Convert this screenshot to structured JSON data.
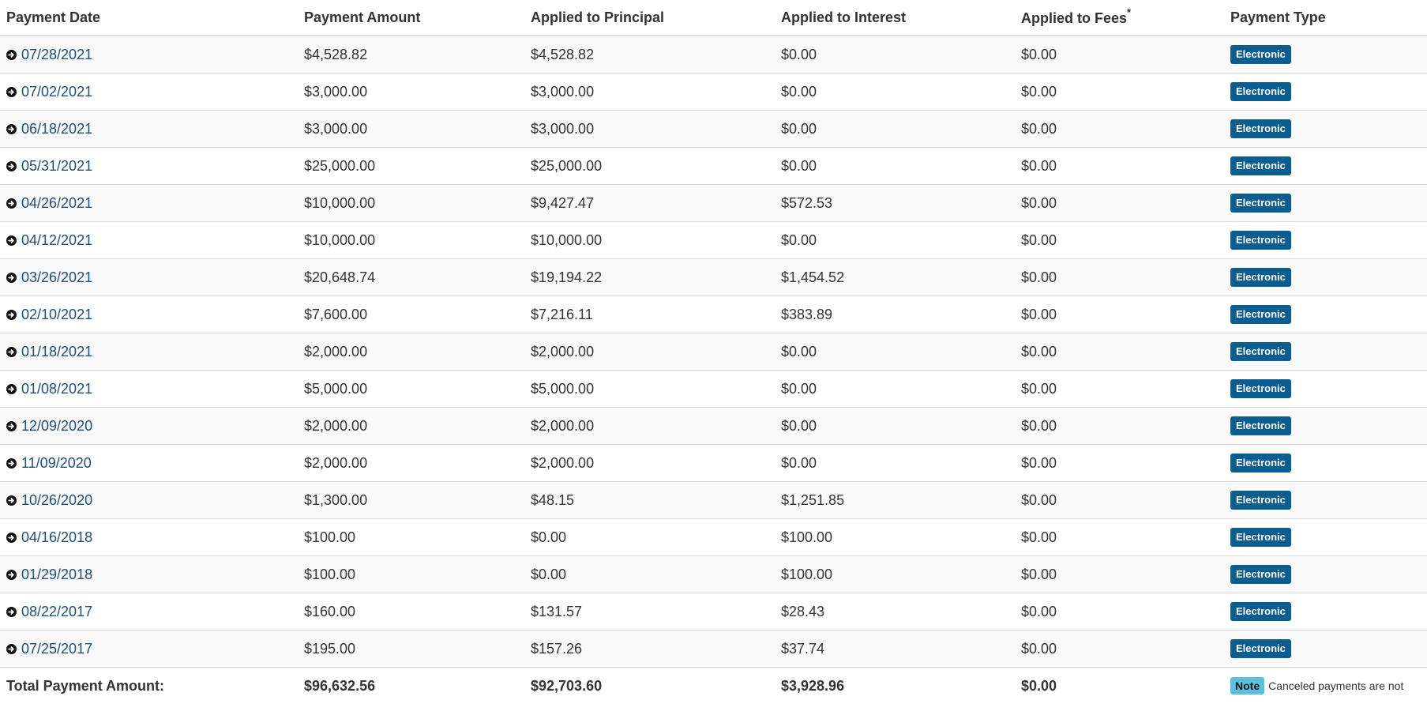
{
  "table": {
    "headers": {
      "payment_date": "Payment Date",
      "payment_amount": "Payment Amount",
      "applied_principal": "Applied to Principal",
      "applied_interest": "Applied to Interest",
      "applied_fees": "Applied to Fees",
      "applied_fees_marker": "*",
      "payment_type": "Payment Type"
    },
    "rows": [
      {
        "date": "07/28/2021",
        "amount": "$4,528.82",
        "principal": "$4,528.82",
        "interest": "$0.00",
        "fees": "$0.00",
        "type": "Electronic"
      },
      {
        "date": "07/02/2021",
        "amount": "$3,000.00",
        "principal": "$3,000.00",
        "interest": "$0.00",
        "fees": "$0.00",
        "type": "Electronic"
      },
      {
        "date": "06/18/2021",
        "amount": "$3,000.00",
        "principal": "$3,000.00",
        "interest": "$0.00",
        "fees": "$0.00",
        "type": "Electronic"
      },
      {
        "date": "05/31/2021",
        "amount": "$25,000.00",
        "principal": "$25,000.00",
        "interest": "$0.00",
        "fees": "$0.00",
        "type": "Electronic"
      },
      {
        "date": "04/26/2021",
        "amount": "$10,000.00",
        "principal": "$9,427.47",
        "interest": "$572.53",
        "fees": "$0.00",
        "type": "Electronic"
      },
      {
        "date": "04/12/2021",
        "amount": "$10,000.00",
        "principal": "$10,000.00",
        "interest": "$0.00",
        "fees": "$0.00",
        "type": "Electronic"
      },
      {
        "date": "03/26/2021",
        "amount": "$20,648.74",
        "principal": "$19,194.22",
        "interest": "$1,454.52",
        "fees": "$0.00",
        "type": "Electronic"
      },
      {
        "date": "02/10/2021",
        "amount": "$7,600.00",
        "principal": "$7,216.11",
        "interest": "$383.89",
        "fees": "$0.00",
        "type": "Electronic"
      },
      {
        "date": "01/18/2021",
        "amount": "$2,000.00",
        "principal": "$2,000.00",
        "interest": "$0.00",
        "fees": "$0.00",
        "type": "Electronic"
      },
      {
        "date": "01/08/2021",
        "amount": "$5,000.00",
        "principal": "$5,000.00",
        "interest": "$0.00",
        "fees": "$0.00",
        "type": "Electronic"
      },
      {
        "date": "12/09/2020",
        "amount": "$2,000.00",
        "principal": "$2,000.00",
        "interest": "$0.00",
        "fees": "$0.00",
        "type": "Electronic"
      },
      {
        "date": "11/09/2020",
        "amount": "$2,000.00",
        "principal": "$2,000.00",
        "interest": "$0.00",
        "fees": "$0.00",
        "type": "Electronic"
      },
      {
        "date": "10/26/2020",
        "amount": "$1,300.00",
        "principal": "$48.15",
        "interest": "$1,251.85",
        "fees": "$0.00",
        "type": "Electronic"
      },
      {
        "date": "04/16/2018",
        "amount": "$100.00",
        "principal": "$0.00",
        "interest": "$100.00",
        "fees": "$0.00",
        "type": "Electronic"
      },
      {
        "date": "01/29/2018",
        "amount": "$100.00",
        "principal": "$0.00",
        "interest": "$100.00",
        "fees": "$0.00",
        "type": "Electronic"
      },
      {
        "date": "08/22/2017",
        "amount": "$160.00",
        "principal": "$131.57",
        "interest": "$28.43",
        "fees": "$0.00",
        "type": "Electronic"
      },
      {
        "date": "07/25/2017",
        "amount": "$195.00",
        "principal": "$157.26",
        "interest": "$37.74",
        "fees": "$0.00",
        "type": "Electronic"
      }
    ],
    "footer": {
      "label": "Total Payment Amount:",
      "amount": "$96,632.56",
      "principal": "$92,703.60",
      "interest": "$3,928.96",
      "fees": "$0.00",
      "note_badge": "Note",
      "note_text": "Canceled payments are not"
    }
  },
  "icons": {
    "row_link": "circle-arrow-right-icon"
  },
  "colors": {
    "link": "#1f4e79",
    "badge_electronic": "#0b5c8f",
    "badge_note": "#5bc0de",
    "row_stripe": "#f9f9f9"
  }
}
